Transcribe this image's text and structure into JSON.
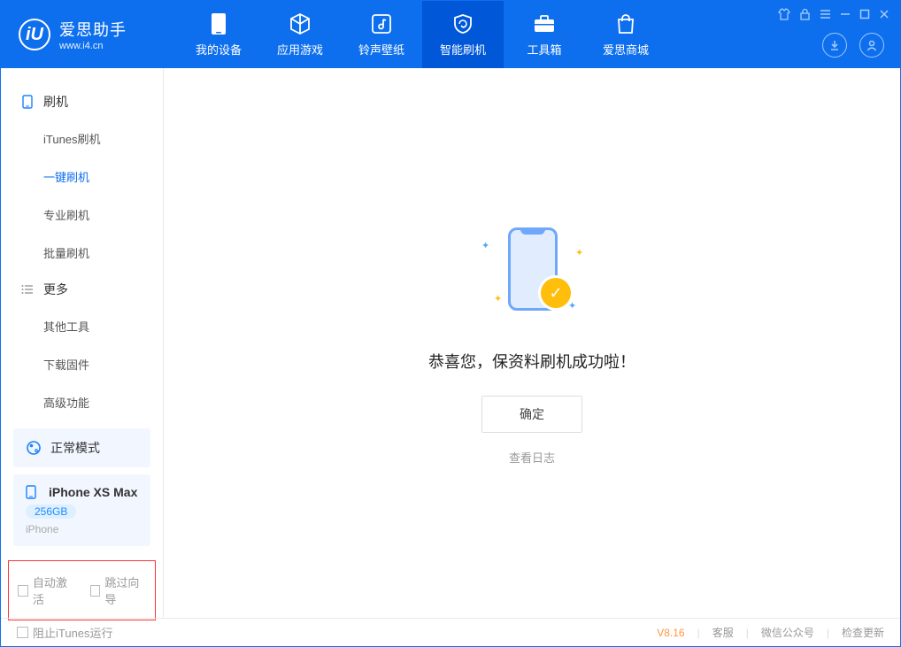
{
  "app": {
    "name": "爱思助手",
    "url": "www.i4.cn"
  },
  "header": {
    "tabs": [
      {
        "label": "我的设备"
      },
      {
        "label": "应用游戏"
      },
      {
        "label": "铃声壁纸"
      },
      {
        "label": "智能刷机"
      },
      {
        "label": "工具箱"
      },
      {
        "label": "爱思商城"
      }
    ]
  },
  "sidebar": {
    "sections": {
      "flash": {
        "title": "刷机",
        "items": [
          "iTunes刷机",
          "一键刷机",
          "专业刷机",
          "批量刷机"
        ]
      },
      "more": {
        "title": "更多",
        "items": [
          "其他工具",
          "下载固件",
          "高级功能"
        ]
      }
    },
    "mode": "正常模式",
    "device": {
      "name": "iPhone XS Max",
      "badge": "256GB",
      "sub": "iPhone"
    },
    "bottom_checks": {
      "auto_activate": "自动激活",
      "skip_guide": "跳过向导"
    }
  },
  "main": {
    "success_text": "恭喜您，保资料刷机成功啦！",
    "ok_button": "确定",
    "log_link": "查看日志"
  },
  "footer": {
    "itunes_block": "阻止iTunes运行",
    "version": "V8.16",
    "links": [
      "客服",
      "微信公众号",
      "检查更新"
    ]
  }
}
